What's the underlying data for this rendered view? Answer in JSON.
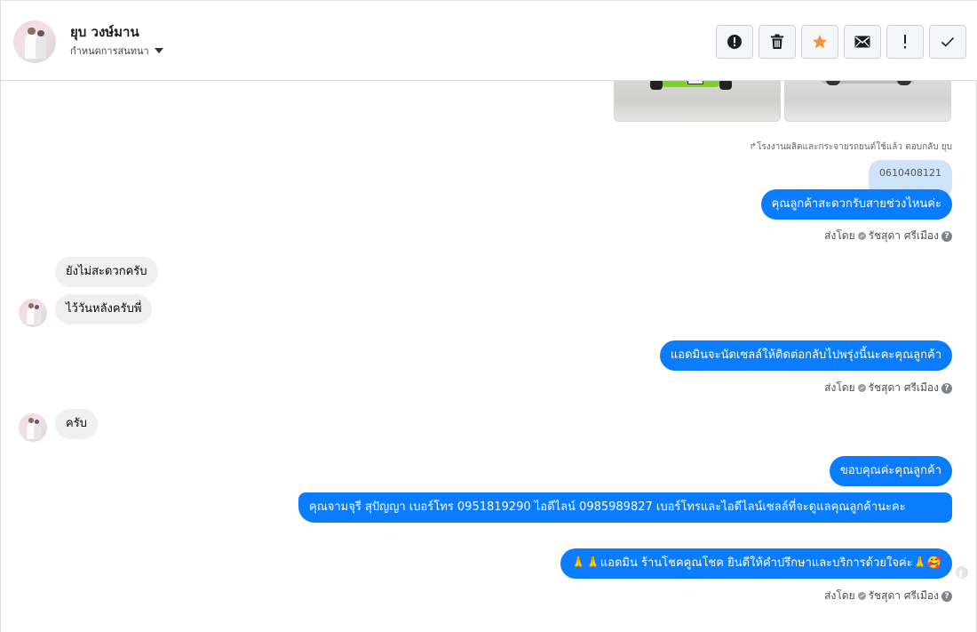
{
  "header": {
    "contact_name": "ยุบ วงษ์มาน",
    "assign_label": "กำหนดการสนทนา"
  },
  "toolbar": {
    "buttons": [
      {
        "name": "spam-alert",
        "icon": "alert-circle-icon"
      },
      {
        "name": "delete",
        "icon": "trash-icon"
      },
      {
        "name": "star",
        "icon": "star-icon",
        "color": "#f7923a"
      },
      {
        "name": "mark-unread",
        "icon": "envelope-icon"
      },
      {
        "name": "follow-up",
        "icon": "exclamation-icon"
      },
      {
        "name": "done",
        "icon": "check-icon"
      }
    ]
  },
  "thread": {
    "reply_note": "โรงงานผลิตและกระจายรถยนต์ใช้แล้ว ตอบกลับ ยุบ",
    "quoted_text": "0610408121",
    "messages": [
      {
        "from": "page",
        "text": "คุณลูกค้าสะดวกรับสายช่วงไหนค่ะ"
      },
      {
        "from": "customer",
        "text": "ยังไม่สะดวกครับ"
      },
      {
        "from": "customer",
        "text": "ไว้วันหลังครับพี่"
      },
      {
        "from": "page",
        "text": "แอดมินจะนัดเซลล์ให้ติดต่อกลับไปพรุ่งนี้นะคะคุณลูกค้า"
      },
      {
        "from": "customer",
        "text": "ครับ"
      },
      {
        "from": "page",
        "text": "ขอบคุณค่ะคุณลูกค้า"
      },
      {
        "from": "page",
        "text": "คุณจามจุรี สุปัญญา เบอร์โทร 0951819290  ไอดีไลน์ 0985989827   เบอร์โทรและไอดีไลน์เซลล์ที่จะดูแลคุณลูกค้านะคะ"
      },
      {
        "from": "page",
        "text": "🙏🙏แอดมิน ร้านโชคคูณโชค ยินดีให้คำปรึกษาและบริการด้วยใจค่ะ🙏🥰"
      }
    ],
    "sent_by_label": "ส่งโดย",
    "sender_name": "รัชสุดา ศรีเมือง",
    "help_glyph": "?"
  },
  "colors": {
    "outgoing_bubble": "#0a7cff",
    "incoming_bubble": "#f0f0f0",
    "quoted_bubble": "#cfe3fb",
    "star": "#f7923a"
  }
}
